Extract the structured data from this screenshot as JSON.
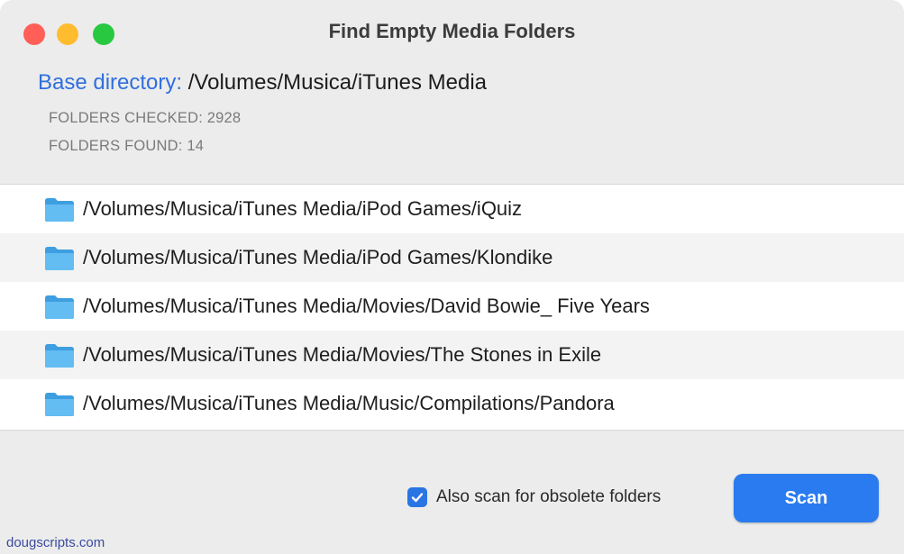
{
  "window": {
    "title": "Find Empty Media Folders"
  },
  "base": {
    "label": "Base directory:",
    "path": "/Volumes/Musica/iTunes Media"
  },
  "stats": {
    "checked": "FOLDERS CHECKED: 2928",
    "found": "FOLDERS FOUND: 14"
  },
  "folders": [
    "/Volumes/Musica/iTunes Media/iPod Games/iQuiz",
    "/Volumes/Musica/iTunes Media/iPod Games/Klondike",
    "/Volumes/Musica/iTunes Media/Movies/David Bowie_ Five Years",
    "/Volumes/Musica/iTunes Media/Movies/The Stones in Exile",
    "/Volumes/Musica/iTunes Media/Music/Compilations/Pandora"
  ],
  "options": {
    "obsolete_label": "Also scan for obsolete folders",
    "obsolete_checked": true
  },
  "actions": {
    "scan_label": "Scan"
  },
  "footer": {
    "site": "dougscripts.com"
  },
  "colors": {
    "accent": "#2a7bf0",
    "label_blue": "#2f6fde",
    "folder_blue": "#5fb8f0"
  }
}
